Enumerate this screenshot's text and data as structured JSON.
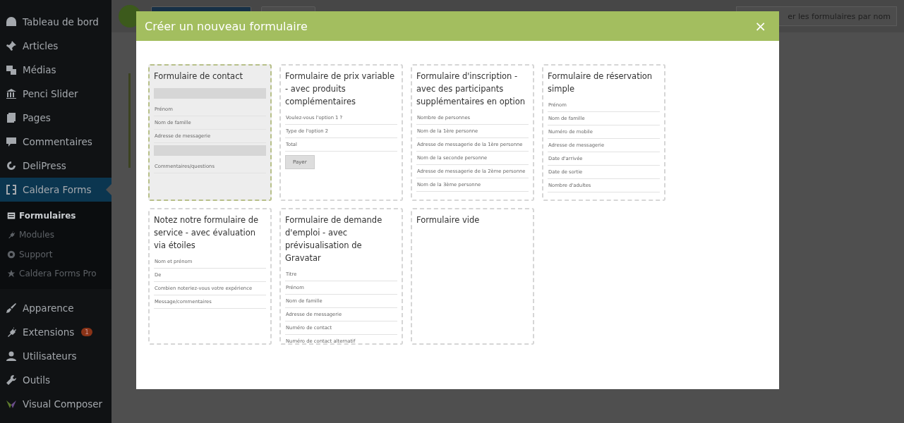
{
  "sidebar": {
    "items": [
      {
        "label": "Tableau de bord",
        "selected": false
      },
      {
        "label": "Articles",
        "selected": false
      },
      {
        "label": "Médias",
        "selected": false
      },
      {
        "label": "Penci Slider",
        "selected": false
      },
      {
        "label": "Pages",
        "selected": false
      },
      {
        "label": "Commentaires",
        "selected": false
      },
      {
        "label": "DeliPress",
        "selected": false
      },
      {
        "label": "Caldera Forms",
        "selected": true,
        "children": [
          {
            "label": "Formulaires",
            "selected": true
          },
          {
            "label": "Modules",
            "selected": false
          },
          {
            "label": "Support",
            "selected": false
          },
          {
            "label": "Caldera Forms Pro",
            "selected": false
          }
        ]
      },
      {
        "label": "Apparence",
        "selected": false
      },
      {
        "label": "Extensions",
        "selected": false,
        "badge": "1"
      },
      {
        "label": "Utilisateurs",
        "selected": false
      },
      {
        "label": "Outils",
        "selected": false
      },
      {
        "label": "Visual Composer",
        "selected": false
      }
    ]
  },
  "background_toolbar": {
    "sort_button": "er les formulaires par nom"
  },
  "modal": {
    "title": "Créer un nouveau formulaire",
    "close": "×",
    "templates": [
      {
        "title": "Formulaire de contact",
        "selected": true,
        "fields": [
          {
            "kind": "block"
          },
          {
            "kind": "field",
            "label": "Prénom"
          },
          {
            "kind": "field",
            "label": "Nom de famille"
          },
          {
            "kind": "field",
            "label": "Adresse de messagerie"
          },
          {
            "kind": "block"
          },
          {
            "kind": "field",
            "label": "Commentaires/questions"
          }
        ]
      },
      {
        "title": "Formulaire de prix variable - avec produits complémentaires",
        "selected": false,
        "fields": [
          {
            "kind": "field",
            "label": "Voulez-vous l'option 1 ?"
          },
          {
            "kind": "field",
            "label": "Type de l'option 2"
          },
          {
            "kind": "field",
            "label": "Total"
          },
          {
            "kind": "button",
            "label": "Payer"
          }
        ]
      },
      {
        "title": "Formulaire d'inscription - avec des participants supplémentaires en option",
        "selected": false,
        "fields": [
          {
            "kind": "field",
            "label": "Nombre de personnes"
          },
          {
            "kind": "field",
            "label": "Nom de la 1ère personne"
          },
          {
            "kind": "field",
            "label": "Adresse de messagerie de la 1ère personne"
          },
          {
            "kind": "field",
            "label": "Nom de la seconde personne"
          },
          {
            "kind": "field",
            "label": "Adresse de messagerie de la 2ème personne"
          },
          {
            "kind": "field",
            "label": "Nom de la 3ème personne"
          }
        ]
      },
      {
        "title": "Formulaire de réservation simple",
        "selected": false,
        "fields": [
          {
            "kind": "field",
            "label": "Prénom"
          },
          {
            "kind": "field",
            "label": "Nom de famille"
          },
          {
            "kind": "field",
            "label": "Numéro de mobile"
          },
          {
            "kind": "field",
            "label": "Adresse de messagerie"
          },
          {
            "kind": "field",
            "label": "Date d'arrivée"
          },
          {
            "kind": "field",
            "label": "Date de sortie"
          },
          {
            "kind": "field",
            "label": "Nombre d'adultes"
          }
        ]
      },
      {
        "title": "Notez notre formulaire de service - avec évaluation via étoiles",
        "selected": false,
        "fields": [
          {
            "kind": "field",
            "label": "Nom et prénom"
          },
          {
            "kind": "field",
            "label": "De"
          },
          {
            "kind": "field",
            "label": "Combien noteriez-vous votre expérience"
          },
          {
            "kind": "field",
            "label": "Message/commentaires"
          }
        ]
      },
      {
        "title": "Formulaire de demande d'emploi - avec prévisualisation de Gravatar",
        "selected": false,
        "fields": [
          {
            "kind": "field",
            "label": "Titre"
          },
          {
            "kind": "field",
            "label": "Prénom"
          },
          {
            "kind": "field",
            "label": "Nom de famille"
          },
          {
            "kind": "field",
            "label": "Adresse de messagerie"
          },
          {
            "kind": "field",
            "label": "Numéro de contact"
          },
          {
            "kind": "field",
            "label": "Numéro de contact alternatif"
          }
        ]
      },
      {
        "title": "Formulaire vide",
        "selected": false
      }
    ]
  }
}
